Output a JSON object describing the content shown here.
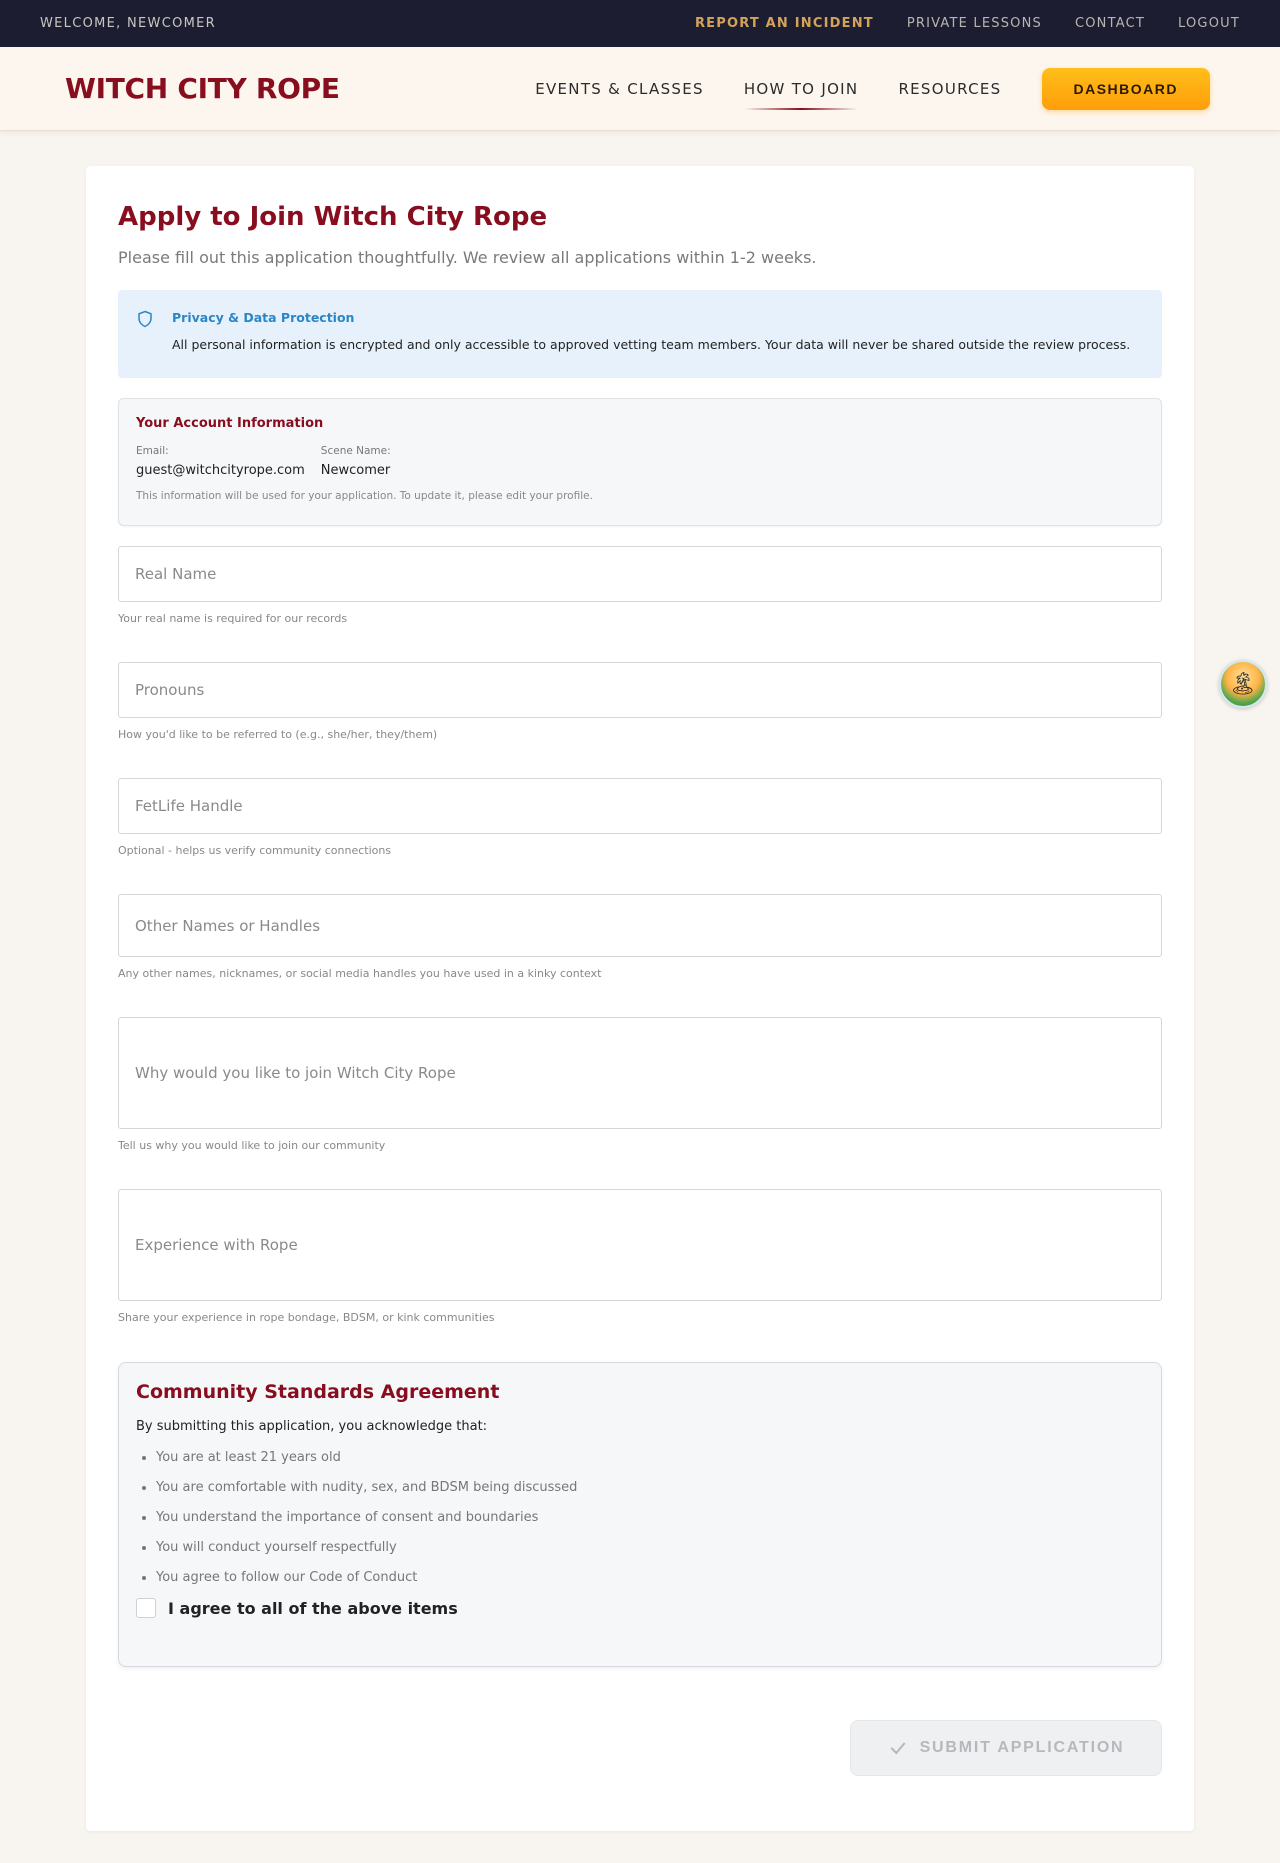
{
  "utility": {
    "welcome": "WELCOME, NEWCOMER",
    "links": [
      "REPORT AN INCIDENT",
      "PRIVATE LESSONS",
      "CONTACT",
      "LOGOUT"
    ]
  },
  "header": {
    "logo": "WITCH CITY ROPE",
    "nav": [
      "EVENTS & CLASSES",
      "HOW TO JOIN",
      "RESOURCES"
    ],
    "active_nav": "HOW TO JOIN",
    "dashboard_label": "DASHBOARD"
  },
  "form": {
    "title": "Apply to Join Witch City Rope",
    "subtitle": "Please fill out this application thoughtfully. We review all applications within 1-2 weeks.",
    "privacy": {
      "title": "Privacy & Data Protection",
      "text": "All personal information is encrypted and only accessible to approved vetting team members. Your data will never be shared outside the review process.",
      "icon": "shield-icon"
    },
    "account": {
      "title": "Your Account Information",
      "email_label": "Email:",
      "email": "guest@witchcityrope.com",
      "scene_label": "Scene Name:",
      "scene_name": "Newcomer",
      "note": "This information will be used for your application. To update it, please edit your profile."
    },
    "fields": {
      "real_name": {
        "placeholder": "Real Name",
        "help": "Your real name is required for our records"
      },
      "pronouns": {
        "placeholder": "Pronouns",
        "help": "How you'd like to be referred to (e.g., she/her, they/them)"
      },
      "fetlife": {
        "placeholder": "FetLife Handle",
        "help": "Optional - helps us verify community connections"
      },
      "other_names": {
        "placeholder": "Other Names or Handles",
        "help": "Any other names, nicknames, or social media handles you have used in a kinky context"
      },
      "why_join": {
        "placeholder": "Why would you like to join Witch City Rope",
        "help": "Tell us why you would like to join our community"
      },
      "experience": {
        "placeholder": "Experience with Rope",
        "help": "Share your experience in rope bondage, BDSM, or kink communities"
      }
    },
    "agreement": {
      "title": "Community Standards Agreement",
      "intro": "By submitting this application, you acknowledge that:",
      "items": [
        "You are at least 21 years old",
        "You are comfortable with nudity, sex, and BDSM being discussed",
        "You understand the importance of consent and boundaries",
        "You will conduct yourself respectfully",
        "You agree to follow our Code of Conduct"
      ],
      "checkbox_label": "I agree to all of the above items"
    },
    "submit_label": "SUBMIT APPLICATION"
  },
  "colors": {
    "brand": "#880d1e",
    "accent": "#ffa90f",
    "utility_bg": "#1c1d31",
    "info_bg": "#e6f1fb"
  }
}
